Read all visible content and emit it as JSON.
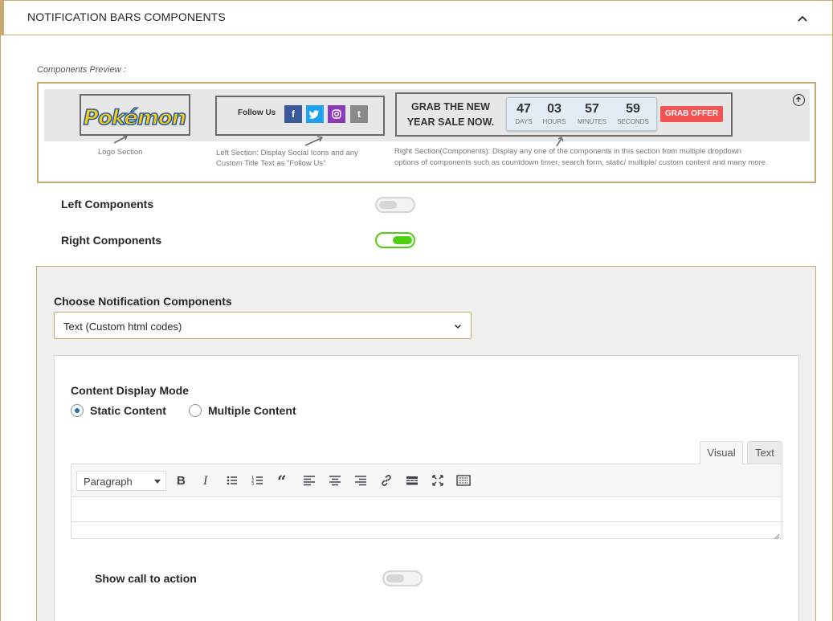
{
  "header": {
    "title": "NOTIFICATION BARS COMPONENTS"
  },
  "preview": {
    "label": "Components Preview :",
    "logo_text": "Pokémon",
    "follow_us": "Follow Us",
    "social": [
      {
        "name": "facebook-icon",
        "glyph": "f",
        "color": "#3b5998"
      },
      {
        "name": "twitter-icon",
        "glyph": "t",
        "color": "#1da1f2"
      },
      {
        "name": "instagram-icon",
        "glyph": "◎",
        "color": "#8a3ab9"
      },
      {
        "name": "tumblr-icon",
        "glyph": "t",
        "color": "#8a8a8a"
      }
    ],
    "grab_text": "GRAB THE NEW YEAR SALE NOW.",
    "countdown": [
      {
        "value": "47",
        "label": "DAYS"
      },
      {
        "value": "03",
        "label": "HOURS"
      },
      {
        "value": "57",
        "label": "MINUTES"
      },
      {
        "value": "59",
        "label": "SECONDS"
      }
    ],
    "grab_button": "GRAB OFFER",
    "captions": {
      "logo": "Logo Section",
      "left_line1": "Left Section: Display Social Icons and any",
      "left_line2": "Custom Title  Text as \"Follow Us\"",
      "right_line1": "Right Section(Components): Display any one of the components in this section from multiple dropdown",
      "right_line2": "options of components such as countdown timer, search form, static/ multiple/ custom content and many more."
    }
  },
  "settings": {
    "left_components": {
      "label": "Left Components",
      "enabled": false
    },
    "right_components": {
      "label": "Right Components",
      "enabled": true
    }
  },
  "components": {
    "choose_label": "Choose Notification Components",
    "selected": "Text (Custom html codes)"
  },
  "content": {
    "mode_label": "Content Display Mode",
    "options": [
      {
        "label": "Static Content",
        "selected": true
      },
      {
        "label": "Multiple Content",
        "selected": false
      }
    ]
  },
  "editor": {
    "tabs": [
      {
        "label": "Visual",
        "active": true
      },
      {
        "label": "Text",
        "active": false
      }
    ],
    "format_value": "Paragraph",
    "toolbar": [
      "bold-icon",
      "italic-icon",
      "bullet-list-icon",
      "numbered-list-icon",
      "blockquote-icon",
      "align-left-icon",
      "align-center-icon",
      "align-right-icon",
      "link-icon",
      "read-more-icon",
      "fullscreen-icon",
      "toolbar-toggle-icon"
    ]
  },
  "cta": {
    "label": "Show call to action",
    "enabled": false
  }
}
